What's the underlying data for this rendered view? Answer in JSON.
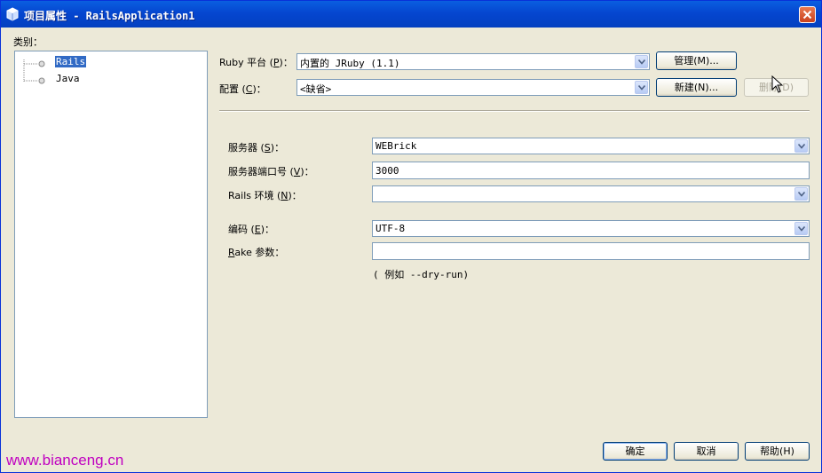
{
  "window": {
    "title": "项目属性 - RailsApplication1"
  },
  "categories": {
    "label": "类别：",
    "items": [
      {
        "label": "Rails",
        "selected": true
      },
      {
        "label": "Java",
        "selected": false
      }
    ]
  },
  "platform": {
    "label_pre": "Ruby 平台 (",
    "label_key": "P",
    "label_post": ")：",
    "value": "内置的 JRuby (1.1)",
    "manage_button": "管理(M)..."
  },
  "config": {
    "label_pre": "配置 (",
    "label_key": "C",
    "label_post": ")：",
    "value": "<缺省>",
    "new_button": "新建(N)...",
    "delete_button": "删除(D)"
  },
  "server": {
    "label_pre": "服务器 (",
    "label_key": "S",
    "label_post": ")：",
    "value": "WEBrick"
  },
  "port": {
    "label_pre": "服务器端口号 (",
    "label_key": "V",
    "label_post": ")：",
    "value": "3000"
  },
  "rails_env": {
    "label_pre": "Rails 环境 (",
    "label_key": "N",
    "label_post": ")：",
    "value": ""
  },
  "encoding": {
    "label_pre": "编码 (",
    "label_key": "E",
    "label_post": ")：",
    "value": "UTF-8"
  },
  "rake": {
    "label_key": "R",
    "label_post": "ake 参数：",
    "value": "",
    "hint": "( 例如 --dry-run)"
  },
  "footer": {
    "ok": "确定",
    "cancel": "取消",
    "help": "帮助(H)"
  },
  "watermark": "www.bianceng.cn",
  "colors": {
    "titlebar": "#0546d0",
    "dialog_bg": "#ece9d8",
    "selection": "#316ac5",
    "watermark": "#c000c0"
  }
}
